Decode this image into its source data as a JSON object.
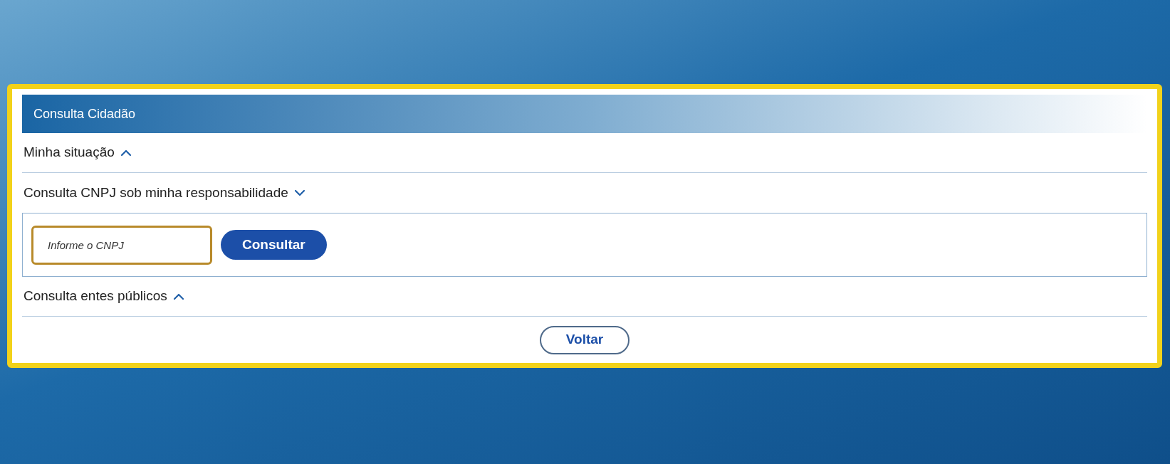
{
  "panel": {
    "title": "Consulta Cidadão"
  },
  "sections": [
    {
      "label": "Minha situação",
      "expanded": false
    },
    {
      "label": "Consulta CNPJ sob minha responsabilidade",
      "expanded": true,
      "field": {
        "placeholder": "Informe o CNPJ"
      },
      "button": "Consultar"
    },
    {
      "label": "Consulta entes públicos",
      "expanded": false
    }
  ],
  "back_button": "Voltar"
}
